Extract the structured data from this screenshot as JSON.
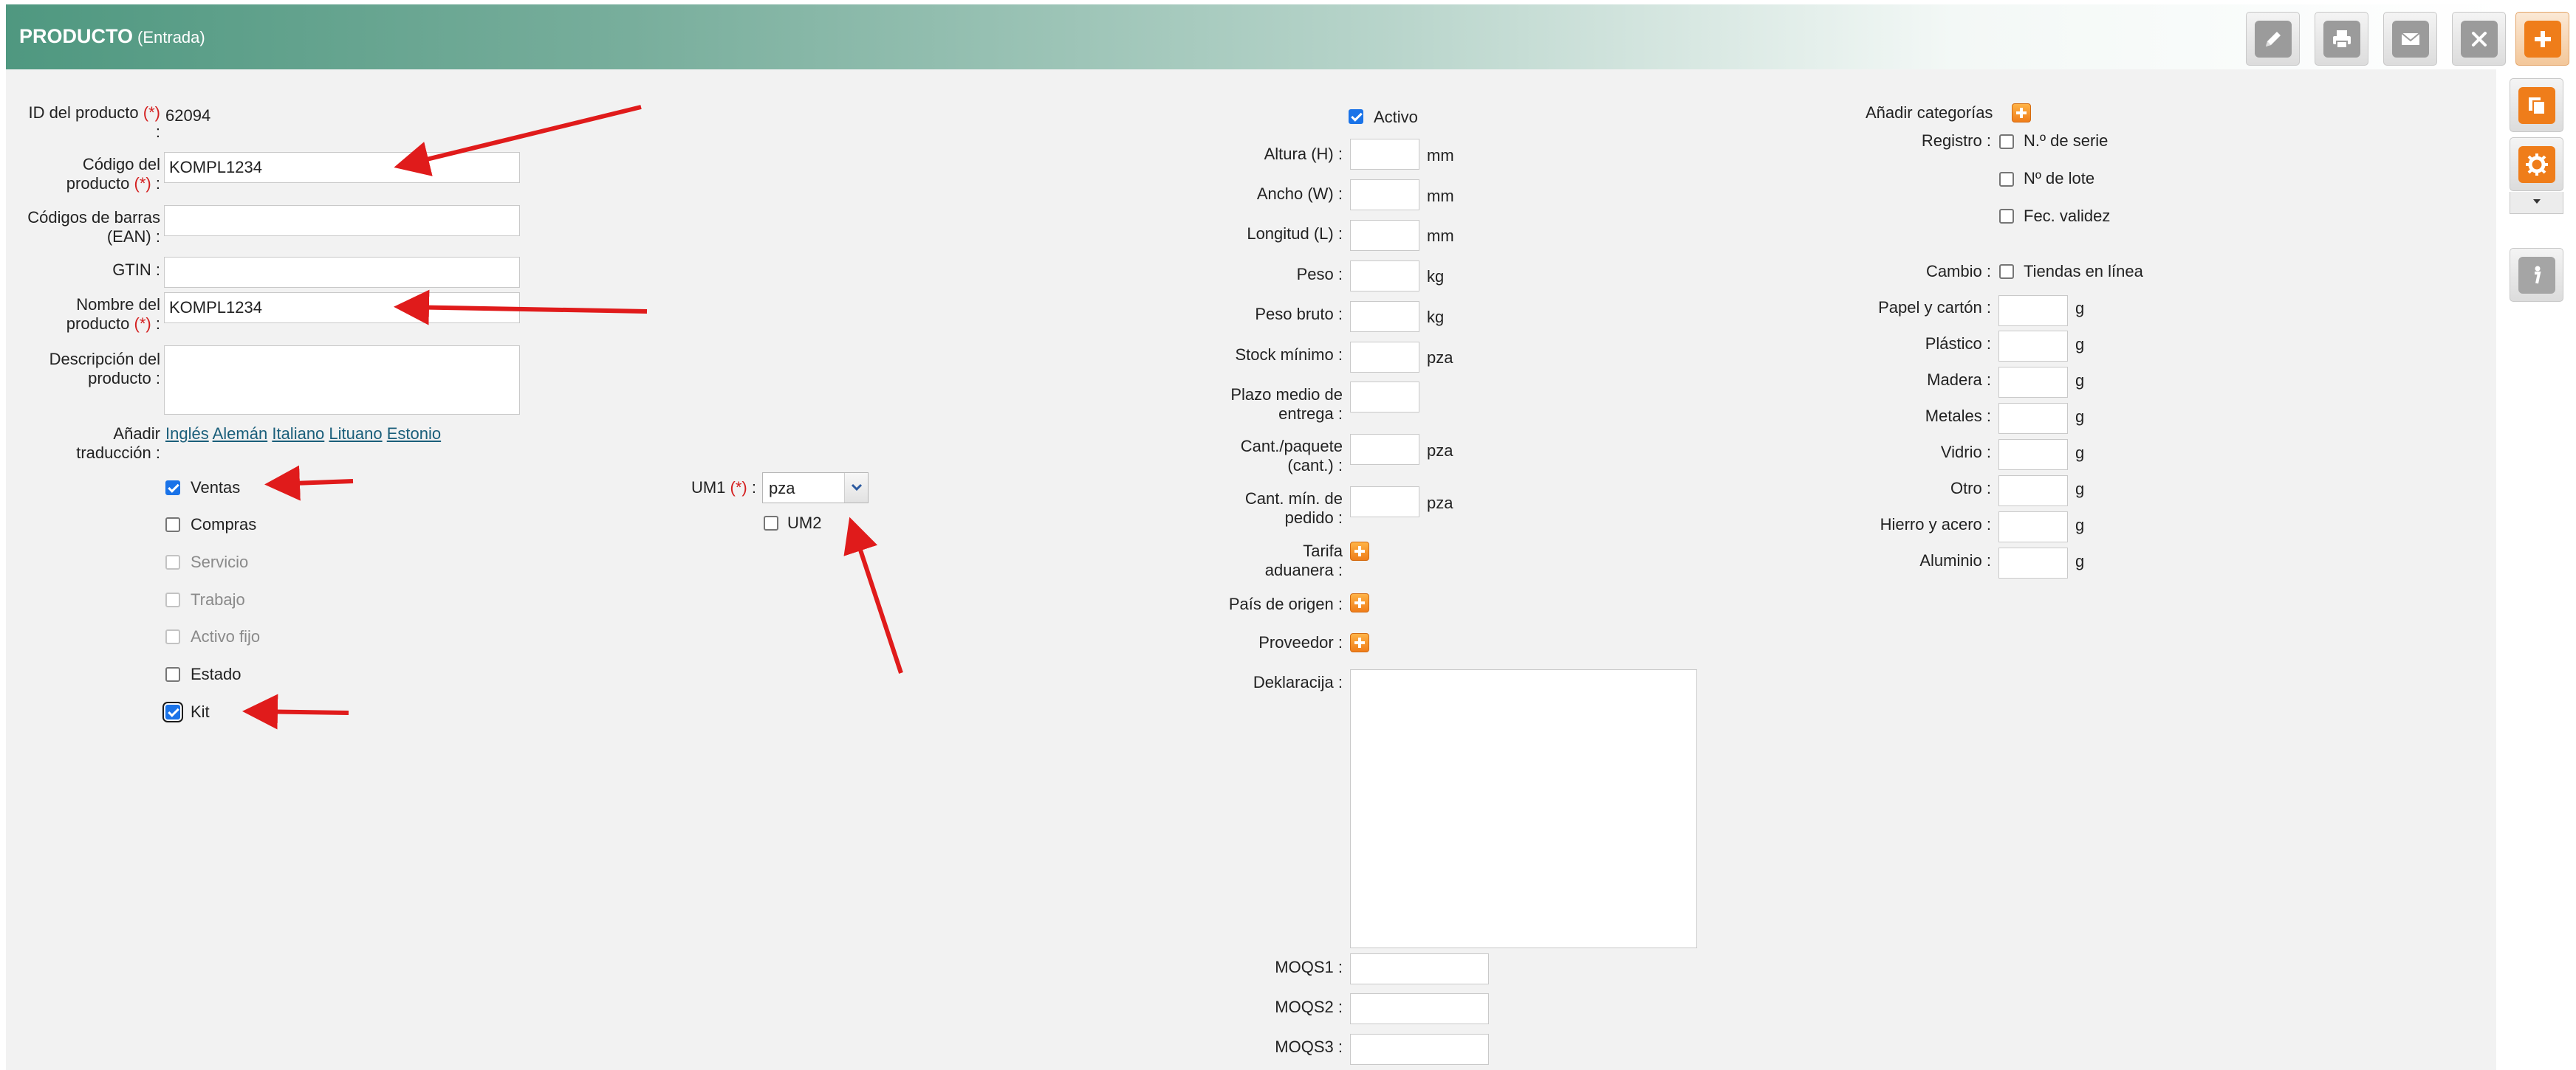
{
  "header": {
    "title": "PRODUCTO",
    "subtitle": "(Entrada)",
    "toolbar": [
      "pencil-icon",
      "printer-icon",
      "mail-icon",
      "close-icon",
      "plus-icon"
    ]
  },
  "side_toolbar": [
    "copy-icon",
    "gear-icon",
    "info-icon"
  ],
  "colors": {
    "header_start": "#4f9880",
    "accent_orange": "#ef7d1a",
    "required": "#d42020",
    "link": "#1a5e7a",
    "annotation_arrow": "#e01b1b"
  },
  "left": {
    "req_mark": "(*)",
    "id_label": "ID del producto",
    "id_value": "62094",
    "code_label_1": "Código del",
    "code_label_2": "producto",
    "code_value": "KOMPL1234",
    "barcode_label_1": "Códigos de barras",
    "barcode_label_2": "(EAN)",
    "barcode_value": "",
    "gtin_label": "GTIN",
    "gtin_value": "",
    "name_label_1": "Nombre del",
    "name_label_2": "producto",
    "name_value": "KOMPL1234",
    "desc_label_1": "Descripción del",
    "desc_label_2": "producto",
    "desc_value": "",
    "trans_label_1": "Añadir",
    "trans_label_2": "traducción",
    "languages": [
      "Inglés",
      "Alemán",
      "Italiano",
      "Lituano",
      "Estonio"
    ],
    "checkboxes": [
      {
        "label": "Ventas",
        "checked": true
      },
      {
        "label": "Compras",
        "checked": false
      },
      {
        "label": "Servicio",
        "checked": false
      },
      {
        "label": "Trabajo",
        "checked": false
      },
      {
        "label": "Activo fijo",
        "checked": false
      },
      {
        "label": "Estado",
        "checked": false
      },
      {
        "label": "Kit",
        "checked": true
      }
    ],
    "um1_label": "UM1",
    "um1_value": "pza",
    "um2_label": "UM2",
    "colon": ":"
  },
  "middle": {
    "active_label": "Activo",
    "height_label": "Altura (H)",
    "width_label": "Ancho (W)",
    "length_label": "Longitud (L)",
    "weight_label": "Peso",
    "gross_label": "Peso bruto",
    "minstock_label": "Stock mínimo",
    "lead_label_1": "Plazo medio de",
    "lead_label_2": "entrega",
    "pack_label_1": "Cant./paquete",
    "pack_label_2": "(cant.)",
    "minorder_label_1": "Cant. mín. de",
    "minorder_label_2": "pedido",
    "tariff_label_1": "Tarifa",
    "tariff_label_2": "aduanera",
    "origin_label": "País de origen",
    "supplier_label": "Proveedor",
    "decl_label": "Deklaracija",
    "moqs1": "MOQS1",
    "moqs2": "MOQS2",
    "moqs3": "MOQS3",
    "unit_mm": "mm",
    "unit_kg": "kg",
    "unit_pza": "pza"
  },
  "right": {
    "add_categories": "Añadir categorías",
    "registro_label": "Registro",
    "serial": "N.º de serie",
    "lot": "Nº de lote",
    "validity": "Fec. validez",
    "cambio_label": "Cambio",
    "online": "Tiendas en línea",
    "materials": [
      "Papel y cartón",
      "Plástico",
      "Madera",
      "Metales",
      "Vidrio",
      "Otro",
      "Hierro y acero",
      "Aluminio"
    ],
    "unit_g": "g"
  }
}
